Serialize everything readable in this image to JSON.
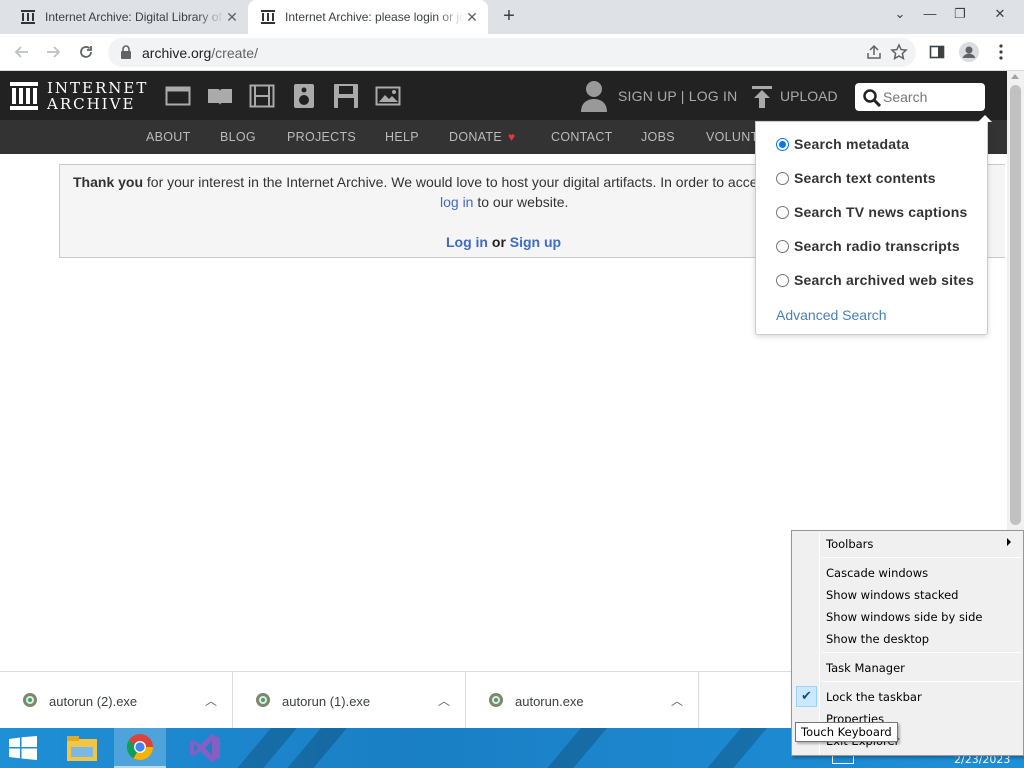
{
  "browser": {
    "tabs": [
      {
        "title": "Internet Archive: Digital Library of Free & Borrowable Books",
        "active": false
      },
      {
        "title": "Internet Archive: please login or join",
        "active": true
      }
    ],
    "url_host": "archive.org",
    "url_path": "/create/"
  },
  "ia_nav": {
    "logo_line1": "INTERNET",
    "logo_line2": "ARCHIVE",
    "media_icons": [
      "web-icon",
      "texts-icon",
      "video-icon",
      "audio-icon",
      "software-icon",
      "images-icon"
    ],
    "signup_label": "SIGN UP | LOG IN",
    "upload_label": "UPLOAD",
    "search_placeholder": "Search"
  },
  "sub_nav": [
    "ABOUT",
    "BLOG",
    "PROJECTS",
    "HELP",
    "DONATE",
    "CONTACT",
    "JOBS",
    "VOLUNT"
  ],
  "notice": {
    "thank_you": "Thank you",
    "line1_rest": " for your interest in the Internet Archive. We would love to host your digital artifacts. In order to acce",
    "line2_link": "log in",
    "line2_rest": " to our website.",
    "login_link": "Log in",
    "or_text": " or ",
    "signup_link": "Sign up"
  },
  "search_menu": {
    "options": [
      {
        "label": "Search metadata",
        "selected": true
      },
      {
        "label": "Search text contents",
        "selected": false
      },
      {
        "label": "Search TV news captions",
        "selected": false
      },
      {
        "label": "Search radio transcripts",
        "selected": false
      },
      {
        "label": "Search archived web sites",
        "selected": false
      }
    ],
    "advanced_label": "Advanced Search"
  },
  "downloads": [
    {
      "name": "autorun (2).exe"
    },
    {
      "name": "autorun (1).exe"
    },
    {
      "name": "autorun.exe"
    }
  ],
  "context_menu": {
    "items": [
      "Toolbars",
      "Cascade windows",
      "Show windows stacked",
      "Show windows side by side",
      "Show the desktop",
      "Task Manager",
      "Lock the taskbar",
      "Properties",
      "Exit Explorer"
    ],
    "checked": "Lock the taskbar"
  },
  "tooltip": "Touch Keyboard",
  "tray": {
    "date": "2/23/2023"
  },
  "colors": {
    "ia_dark": "#222222",
    "ia_sub": "#333333",
    "link": "#3f6bc4",
    "radio_on": "#0075ff",
    "taskbar": "#1a7fc5"
  }
}
